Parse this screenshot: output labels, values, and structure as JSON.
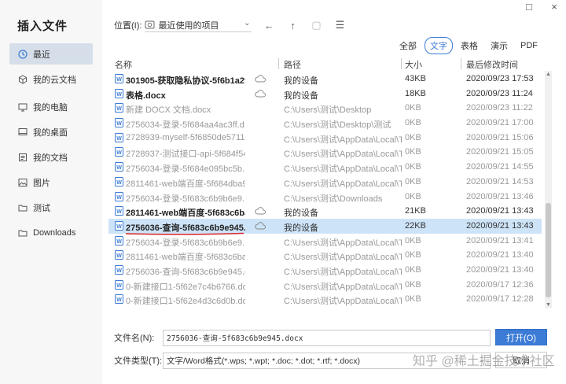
{
  "app_title": "插入文件",
  "window_controls": [
    "□",
    "×"
  ],
  "sidebar": {
    "items": [
      {
        "label": "最近",
        "icon": "clock-icon",
        "active": true
      },
      {
        "label": "我的云文档",
        "icon": "cloud-doc-icon",
        "active": false
      },
      {
        "label": "我的电脑",
        "icon": "computer-icon",
        "active": false
      },
      {
        "label": "我的桌面",
        "icon": "desktop-icon",
        "active": false
      },
      {
        "label": "我的文档",
        "icon": "documents-icon",
        "active": false
      },
      {
        "label": "图片",
        "icon": "picture-icon",
        "active": false
      },
      {
        "label": "测试",
        "icon": "folder-icon",
        "active": false
      },
      {
        "label": "Downloads",
        "icon": "folder-icon",
        "active": false
      }
    ]
  },
  "toolbar": {
    "location_label": "位置(I):",
    "location_value": "最近使用的项目",
    "location_icon": "recent-items-icon",
    "back_icon": "back-arrow-icon",
    "up_icon": "up-arrow-icon",
    "new_folder_icon": "new-folder-icon"
  },
  "filters": [
    {
      "label": "全部",
      "active": false
    },
    {
      "label": "文字",
      "active": true
    },
    {
      "label": "表格",
      "active": false
    },
    {
      "label": "演示",
      "active": false
    },
    {
      "label": "PDF",
      "active": false
    }
  ],
  "columns": {
    "name": "名称",
    "path": "路径",
    "size": "大小",
    "modified": "最后修改时间"
  },
  "rows": [
    {
      "name": "301905-获取隐私协议-5f6b1a2f3...",
      "cloud": true,
      "path": "我的设备",
      "size": "43KB",
      "date": "2020/09/23 17:53",
      "style": "bold"
    },
    {
      "name": "表格.docx",
      "cloud": true,
      "path": "我的设备",
      "size": "18KB",
      "date": "2020/09/23 11:24",
      "style": "bold"
    },
    {
      "name": "新建 DOCX 文档.docx",
      "cloud": false,
      "path": "C:\\Users\\测试\\Desktop",
      "size": "0KB",
      "date": "2020/09/23 11:22",
      "style": "dim"
    },
    {
      "name": "2756034-登录-5f684aa4ac3ff.d...",
      "cloud": false,
      "path": "C:\\Users\\测试\\Desktop\\测试",
      "size": "0KB",
      "date": "2020/09/21 17:00",
      "style": "dim"
    },
    {
      "name": "2728939-myself-5f6850de5711...",
      "cloud": false,
      "path": "C:\\Users\\测试\\AppData\\Local\\T...",
      "size": "0KB",
      "date": "2020/09/21 15:06",
      "style": "dim"
    },
    {
      "name": "2728937-测试接口-api-5f684f54...",
      "cloud": false,
      "path": "C:\\Users\\测试\\AppData\\Local\\T...",
      "size": "0KB",
      "date": "2020/09/21 15:05",
      "style": "dim"
    },
    {
      "name": "2756034-登录-5f684e095bc5b...",
      "cloud": false,
      "path": "C:\\Users\\测试\\AppData\\Local\\T...",
      "size": "0KB",
      "date": "2020/09/21 14:55",
      "style": "dim"
    },
    {
      "name": "2811461-web端百度-5f684dba9...",
      "cloud": false,
      "path": "C:\\Users\\测试\\AppData\\Local\\T...",
      "size": "0KB",
      "date": "2020/09/21 14:53",
      "style": "dim"
    },
    {
      "name": "2756034-登录-5f683c6b9b6e9...",
      "cloud": false,
      "path": "C:\\Users\\测试\\Downloads",
      "size": "0KB",
      "date": "2020/09/21 13:46",
      "style": "dim"
    },
    {
      "name": "2811461-web端百度-5f683c6ba...",
      "cloud": true,
      "path": "我的设备",
      "size": "21KB",
      "date": "2020/09/21 13:43",
      "style": "bold"
    },
    {
      "name": "2756036-查询-5f683c6b9e945.d...",
      "cloud": true,
      "path": "我的设备",
      "size": "22KB",
      "date": "2020/09/21 13:43",
      "style": "selected"
    },
    {
      "name": "2756034-登录-5f683c6b9b6e9...",
      "cloud": false,
      "path": "C:\\Users\\测试\\AppData\\Local\\T...",
      "size": "0KB",
      "date": "2020/09/21 13:41",
      "style": "dim"
    },
    {
      "name": "2811461-web端百度-5f683c6ba...",
      "cloud": false,
      "path": "C:\\Users\\测试\\AppData\\Local\\T...",
      "size": "0KB",
      "date": "2020/09/21 13:40",
      "style": "dim"
    },
    {
      "name": "2756036-查询-5f683c6b9e945.d...",
      "cloud": false,
      "path": "C:\\Users\\测试\\AppData\\Local\\T...",
      "size": "0KB",
      "date": "2020/09/21 13:40",
      "style": "dim"
    },
    {
      "name": "0-新建接口1-5f62e7c4b6766.docx",
      "cloud": false,
      "path": "C:\\Users\\测试\\AppData\\Local\\T...",
      "size": "0KB",
      "date": "2020/09/17 12:36",
      "style": "dim"
    },
    {
      "name": "0-新建接口1-5f62e4d3c6d0b.do...",
      "cloud": false,
      "path": "C:\\Users\\测试\\AppData\\Local\\T...",
      "size": "0KB",
      "date": "2020/09/17 12:28",
      "style": "dim"
    }
  ],
  "bottom": {
    "filename_label": "文件名(N):",
    "filename_value": "2756036-查询-5f683c6b9e945.docx",
    "filetype_label": "文件类型(T):",
    "filetype_value": "文字/Word格式(*.wps; *.wpt; *.doc; *.dot; *.rtf; *.docx)",
    "open_label": "打开(O)",
    "cancel_label": "取消"
  },
  "watermark": "知乎 @稀土掘金技术社区",
  "colors": {
    "accent": "#3c7bd6",
    "selected_row": "#cde3f7",
    "sidebar_active": "#d6dfe9",
    "annotation_red": "#d9252a"
  }
}
